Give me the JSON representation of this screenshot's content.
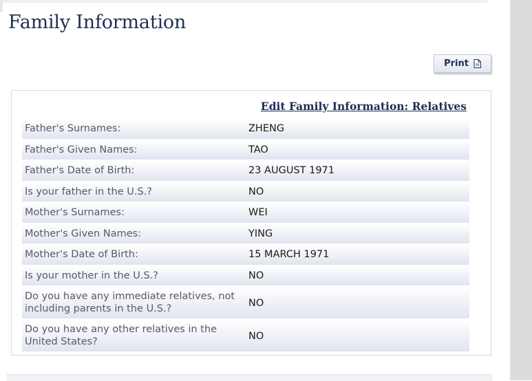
{
  "page": {
    "title": "Family Information"
  },
  "toolbar": {
    "print_label": "Print",
    "print_icon": "document-icon"
  },
  "section": {
    "edit_link": "Edit Family Information: Relatives"
  },
  "rows": [
    {
      "label": "Father's Surnames:",
      "value": "ZHENG"
    },
    {
      "label": "Father's Given Names:",
      "value": "TAO"
    },
    {
      "label": "Father's Date of Birth:",
      "value": "23 AUGUST 1971"
    },
    {
      "label": "Is your father in the U.S.?",
      "value": "NO"
    },
    {
      "label": "Mother's Surnames:",
      "value": "WEI"
    },
    {
      "label": "Mother's Given Names:",
      "value": "YING"
    },
    {
      "label": "Mother's Date of Birth:",
      "value": "15 MARCH 1971"
    },
    {
      "label": "Is your mother in the U.S.?",
      "value": "NO"
    },
    {
      "label": "Do you have any immediate relatives, not including parents in the U.S.?",
      "value": "NO"
    },
    {
      "label": "Do you have any other relatives in the United States?",
      "value": "NO"
    }
  ],
  "colors": {
    "heading": "#1f2e55",
    "label_text": "#555a66",
    "value_text": "#1a1a1a",
    "side_strip": "#dcdcdc"
  }
}
